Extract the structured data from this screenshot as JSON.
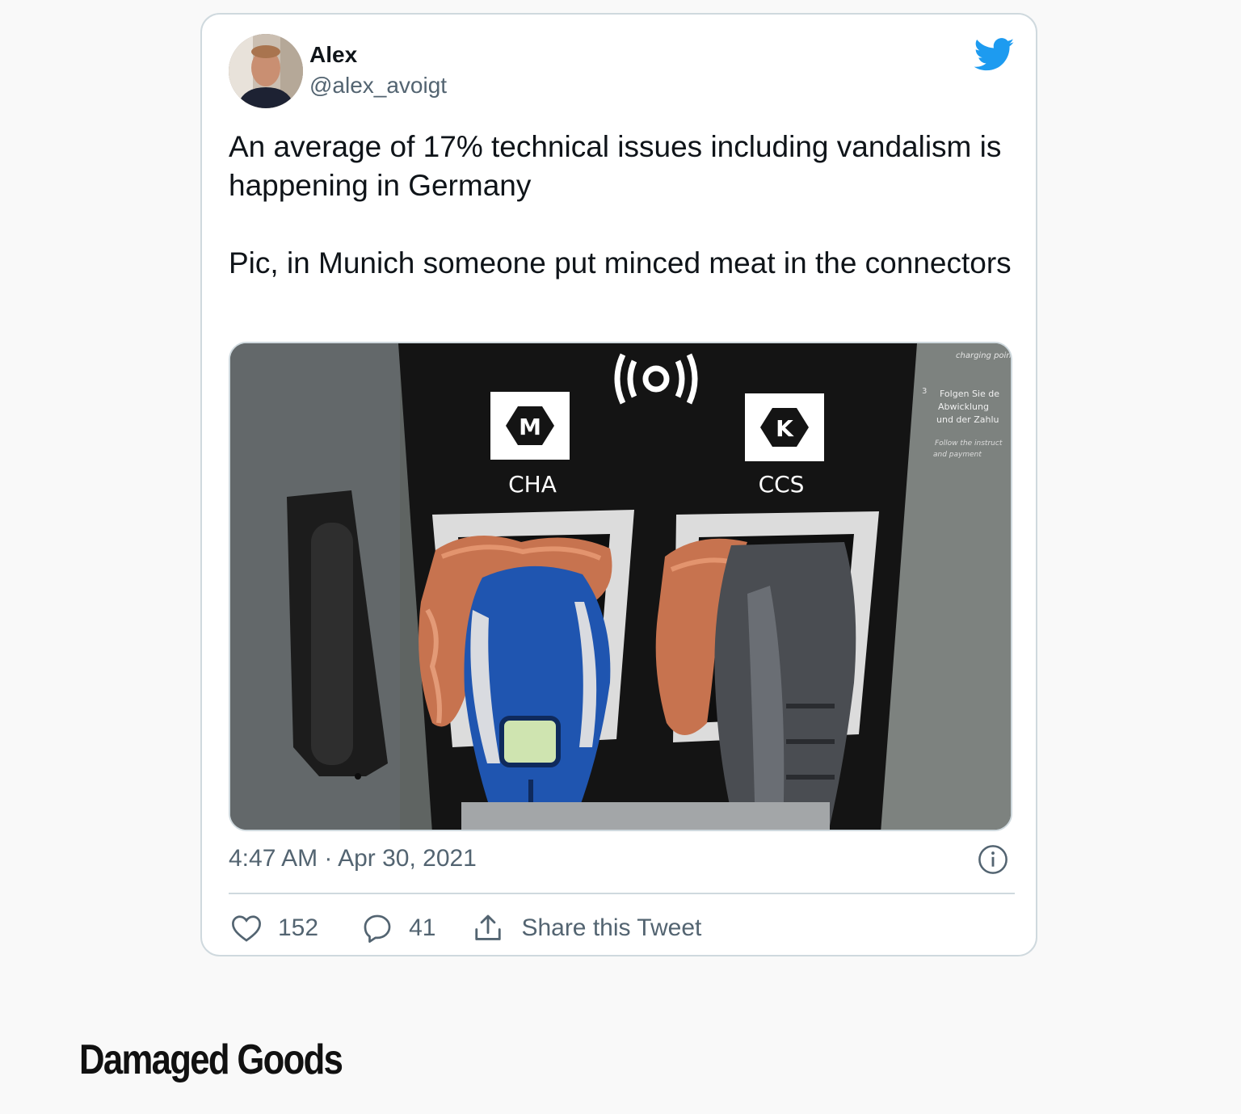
{
  "tweet": {
    "author": {
      "name": "Alex",
      "handle": "@alex_avoigt",
      "avatar_icon": "avatar-photo"
    },
    "brand_icon": "twitter-bird-icon",
    "brand_color": "#1d9bf0",
    "text_paragraphs": [
      "An average of 17% technical issues including vandalism is happening in Germany",
      "Pic, in Munich someone put minced meat in the connectors"
    ],
    "media": {
      "description_icon": "charging-station-photo",
      "labels": {
        "left_badge": "M",
        "left_type": "CHA",
        "right_badge": "K",
        "right_type": "CCS",
        "sign_step": "3",
        "sign_line1": "Folgen Sie de",
        "sign_line2": "Abwicklung",
        "sign_line3": "und der Zahlu",
        "sign_line4": "Follow the instruct",
        "sign_line5": "and payment",
        "sign_top": "charging point"
      }
    },
    "timestamp": "4:47 AM · Apr 30, 2021",
    "actions": {
      "like_count": "152",
      "reply_count": "41",
      "share_label": "Share this Tweet"
    }
  },
  "section": {
    "title": "Damaged Goods"
  },
  "colors": {
    "text_primary": "#0f1419",
    "text_secondary": "#536471",
    "border": "#cfd9de"
  }
}
